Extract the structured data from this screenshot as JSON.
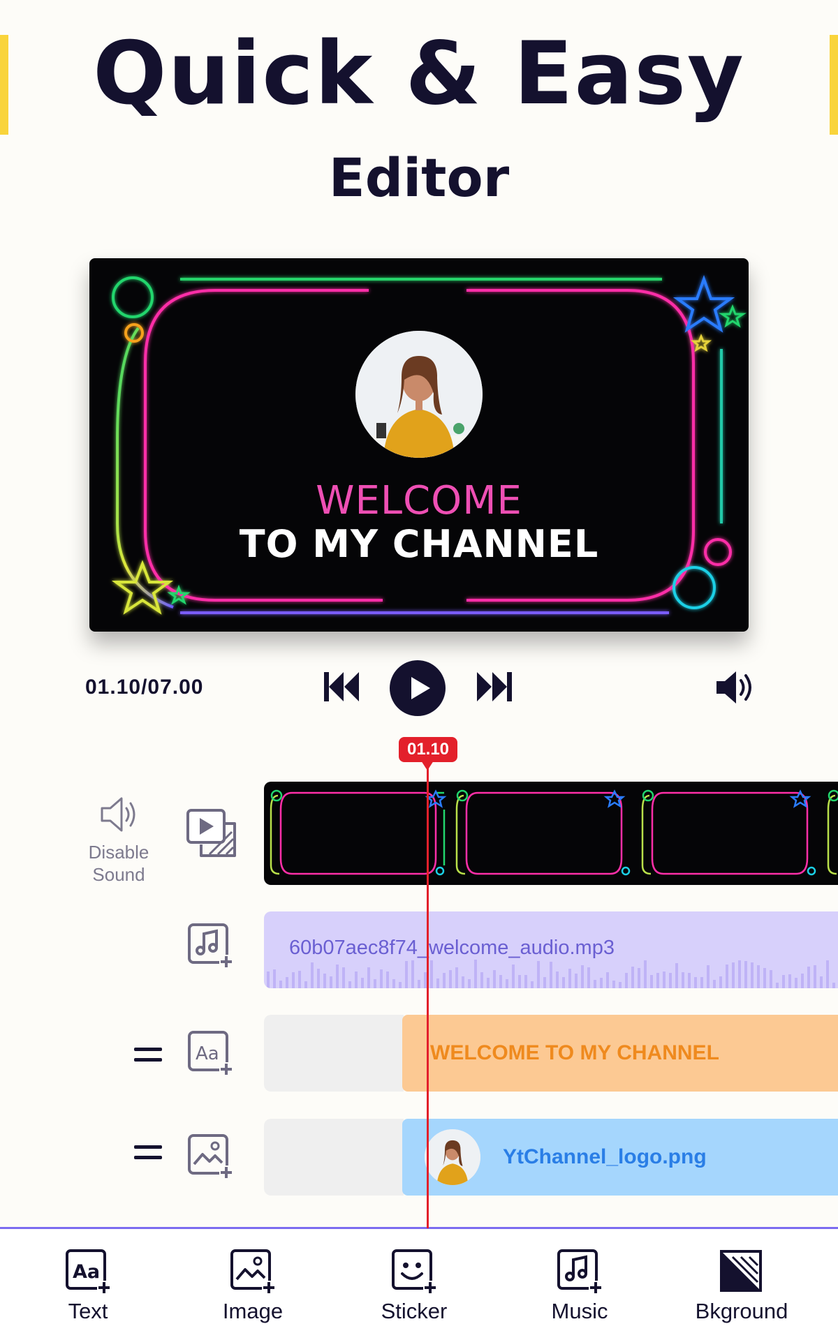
{
  "header": {
    "title": "Quick & Easy",
    "subtitle": "Editor"
  },
  "preview": {
    "welcome_text": "WELCOME",
    "channel_text": "TO MY CHANNEL"
  },
  "player": {
    "time": "01.10/07.00",
    "playhead_label": "01.10"
  },
  "tracks": {
    "sound_toggle_label": "Disable Sound",
    "audio_file": "60b07aec8f74_welcome_audio.mp3",
    "text_clip": "WELCOME TO MY CHANNEL",
    "image_clip": "YtChannel_logo.png"
  },
  "toolbar": {
    "items": [
      {
        "label": "Text",
        "icon": "text-add-icon"
      },
      {
        "label": "Image",
        "icon": "image-add-icon"
      },
      {
        "label": "Sticker",
        "icon": "sticker-add-icon"
      },
      {
        "label": "Music",
        "icon": "music-add-icon"
      },
      {
        "label": "Bkground",
        "icon": "background-icon"
      }
    ]
  },
  "colors": {
    "accent_yellow": "#f9d43b",
    "playhead_red": "#e3202b",
    "audio_clip": "#d7d0fb",
    "text_clip": "#fcc993",
    "image_clip": "#a5d6fd",
    "toolbar_line": "#7c6cf0"
  }
}
